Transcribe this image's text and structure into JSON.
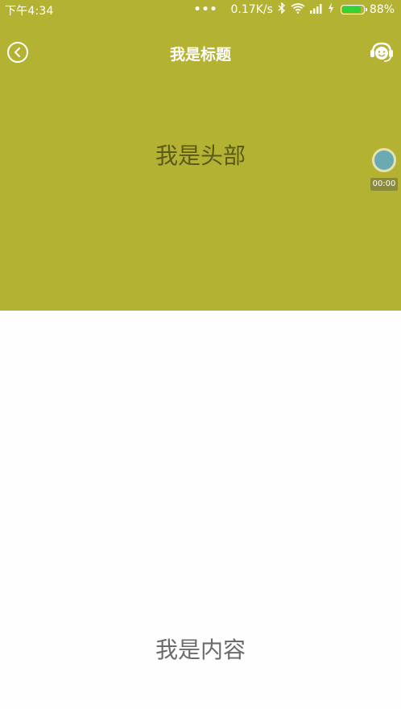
{
  "status_bar": {
    "time": "下午4:34",
    "dots": "•••",
    "net_speed": "0.17K/s",
    "battery_level": 0.88,
    "battery_pct": "88%",
    "battery_color": "#35d235"
  },
  "nav": {
    "title": "我是标题",
    "back_icon": "chevron-left-circle-icon",
    "service_icon": "customer-service-icon"
  },
  "hero": {
    "text": "我是头部",
    "background": "#b4b233"
  },
  "float_recorder": {
    "time": "00:00",
    "color": "#6aaab3"
  },
  "content": {
    "text": "我是内容"
  }
}
